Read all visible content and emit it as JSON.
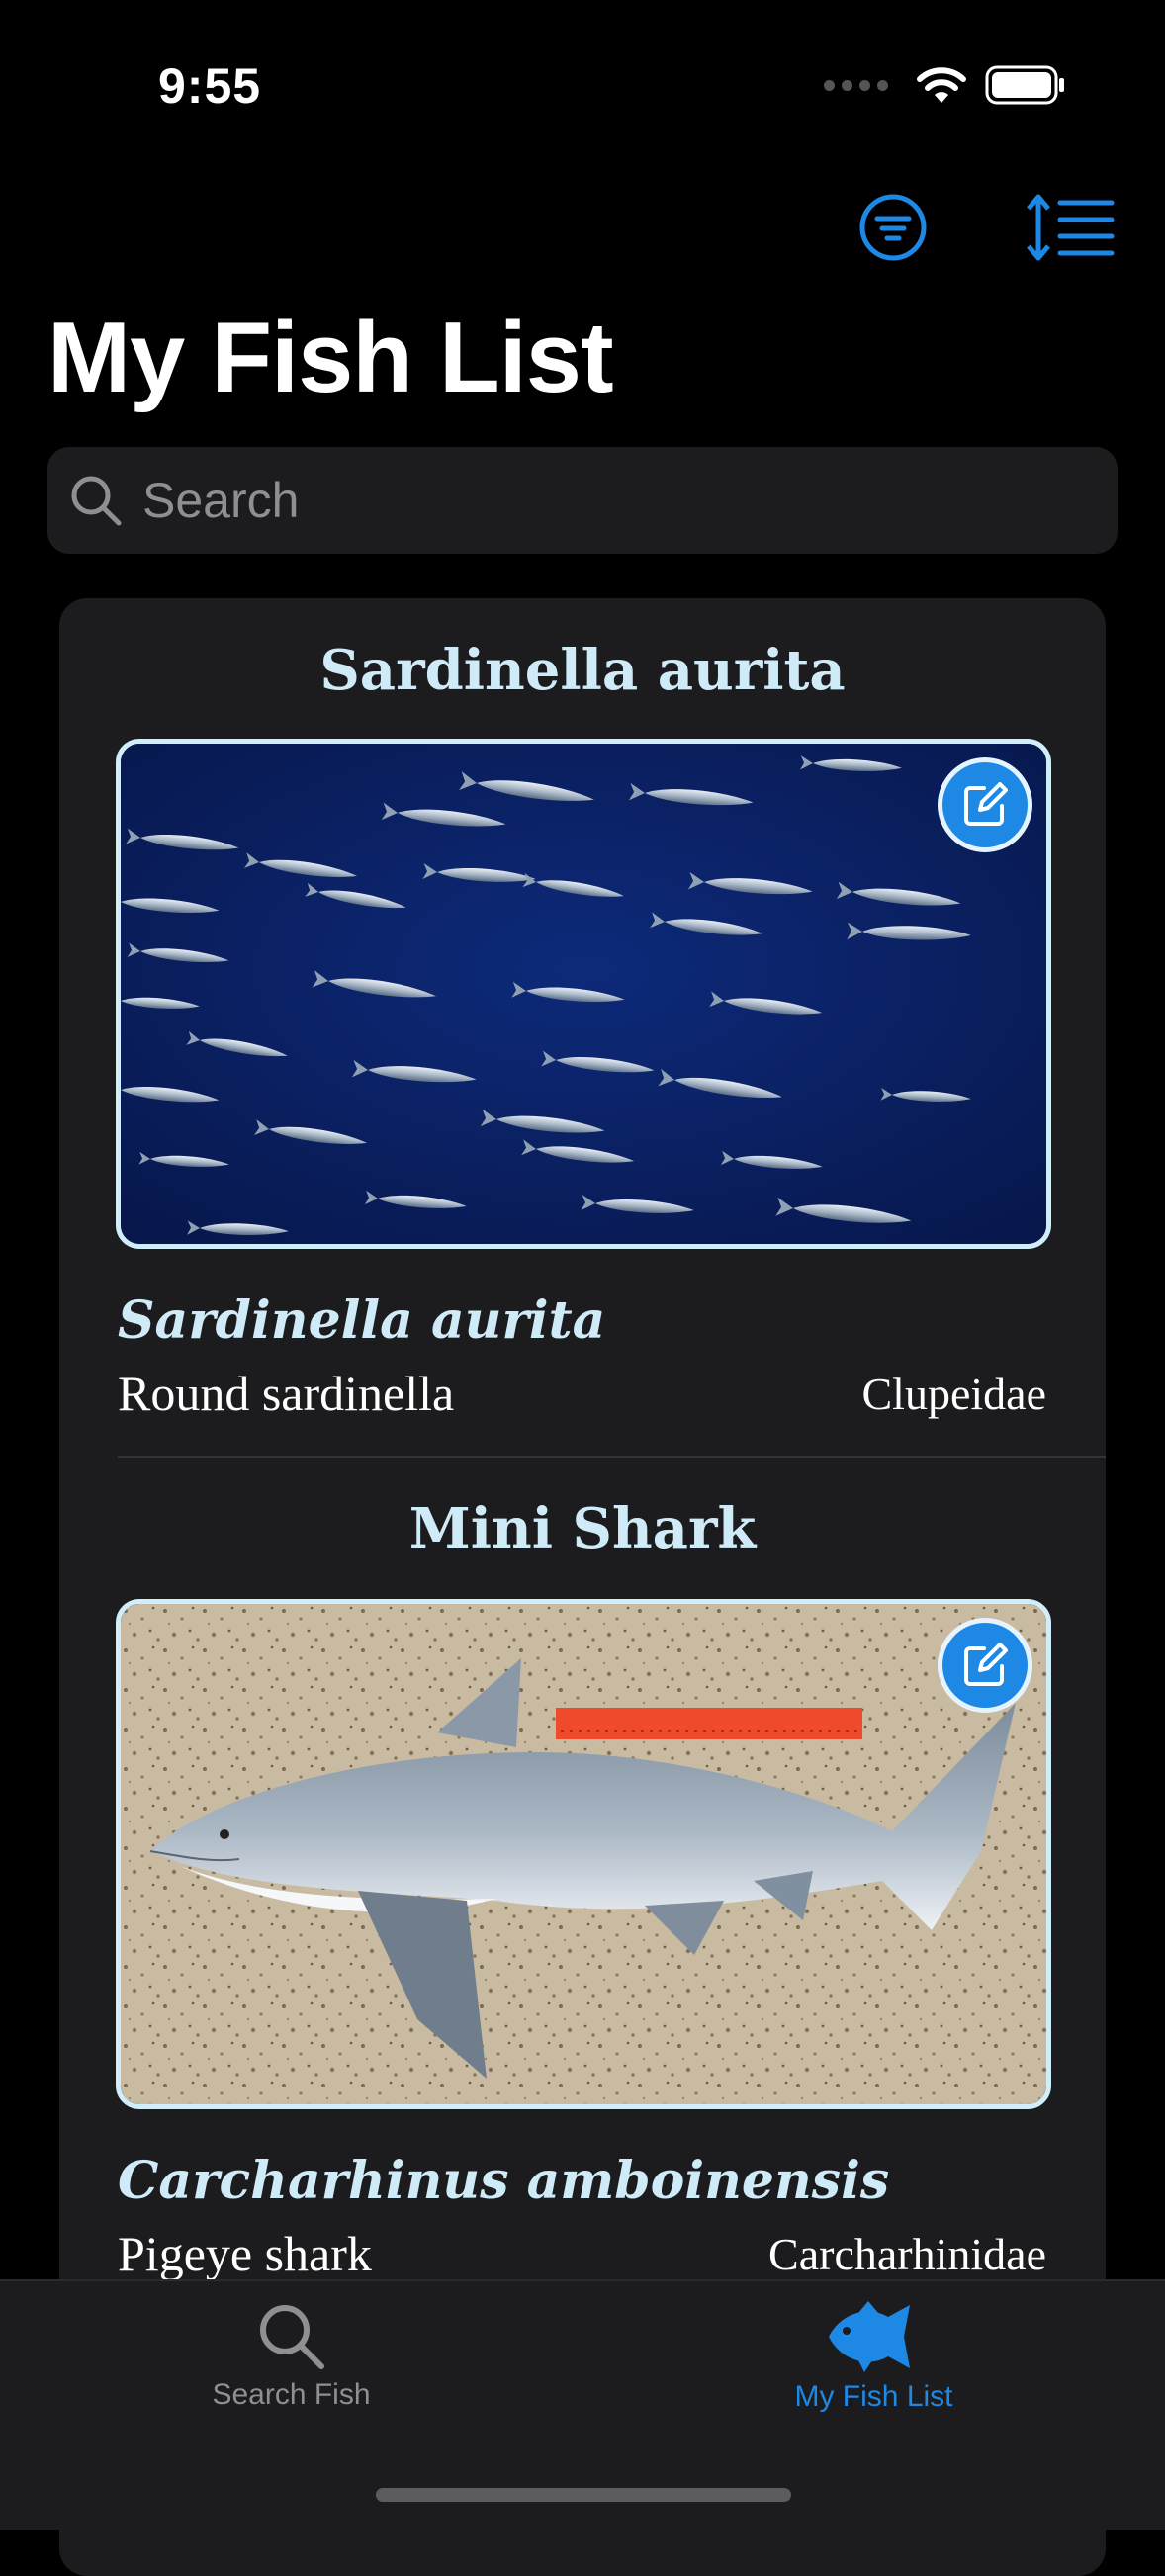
{
  "status_bar": {
    "time": "9:55"
  },
  "header": {
    "title": "My Fish List",
    "filter_icon": "filter-circle-icon",
    "sort_icon": "sort-list-icon"
  },
  "search": {
    "placeholder": "Search"
  },
  "fish_list": [
    {
      "title": "Sardinella aurita",
      "scientific_name": "Sardinella aurita",
      "common_name": "Round sardinella",
      "family": "Clupeidae",
      "image": "school-of-sardines-underwater"
    },
    {
      "title": "Mini Shark",
      "scientific_name": "Carcharhinus amboinensis",
      "common_name": "Pigeye shark",
      "family": "Carcharhinidae",
      "image": "shark-on-sand-with-ruler"
    }
  ],
  "tab_bar": {
    "tabs": [
      {
        "label": "Search Fish",
        "icon": "magnifier-icon",
        "active": false
      },
      {
        "label": "My Fish List",
        "icon": "fish-icon",
        "active": true
      }
    ]
  },
  "colors": {
    "accent": "#1e88e5",
    "title_text": "#d0ebf8",
    "inactive_tab": "#8e8e93"
  }
}
